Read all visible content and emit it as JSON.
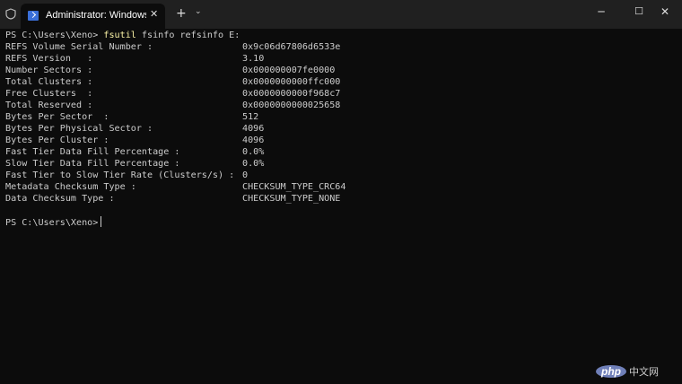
{
  "tab": {
    "title": "Administrator: Windows PowerShell",
    "close": "✕"
  },
  "titlebar": {
    "new_tab": "+",
    "dropdown": "⌄",
    "minimize": "─",
    "maximize": "☐",
    "close": "✕"
  },
  "terminal": {
    "prompt": "PS C:\\Users\\Xeno> ",
    "command": "fsutil",
    "args": " fsinfo refsinfo E:",
    "rows": [
      {
        "label": "REFS Volume Serial Number :",
        "value": "0x9c06d67806d6533e"
      },
      {
        "label": "REFS Version   :",
        "value": "3.10"
      },
      {
        "label": "Number Sectors :",
        "value": "0x000000007fe0000"
      },
      {
        "label": "Total Clusters :",
        "value": "0x0000000000ffc000"
      },
      {
        "label": "Free Clusters  :",
        "value": "0x0000000000f968c7"
      },
      {
        "label": "Total Reserved :",
        "value": "0x0000000000025658"
      },
      {
        "label": "Bytes Per Sector  :",
        "value": "512"
      },
      {
        "label": "Bytes Per Physical Sector :",
        "value": "4096"
      },
      {
        "label": "Bytes Per Cluster :",
        "value": "4096"
      },
      {
        "label": "Fast Tier Data Fill Percentage :",
        "value": "0.0%"
      },
      {
        "label": "Slow Tier Data Fill Percentage :",
        "value": "0.0%"
      },
      {
        "label": "Fast Tier to Slow Tier Rate (Clusters/s) :",
        "value": "0"
      },
      {
        "label": "Metadata Checksum Type :",
        "value": "CHECKSUM_TYPE_CRC64"
      },
      {
        "label": "Data Checksum Type :",
        "value": "CHECKSUM_TYPE_NONE"
      }
    ],
    "final_prompt": "PS C:\\Users\\Xeno>"
  },
  "watermark": {
    "logo": "php",
    "text": "中文网"
  }
}
